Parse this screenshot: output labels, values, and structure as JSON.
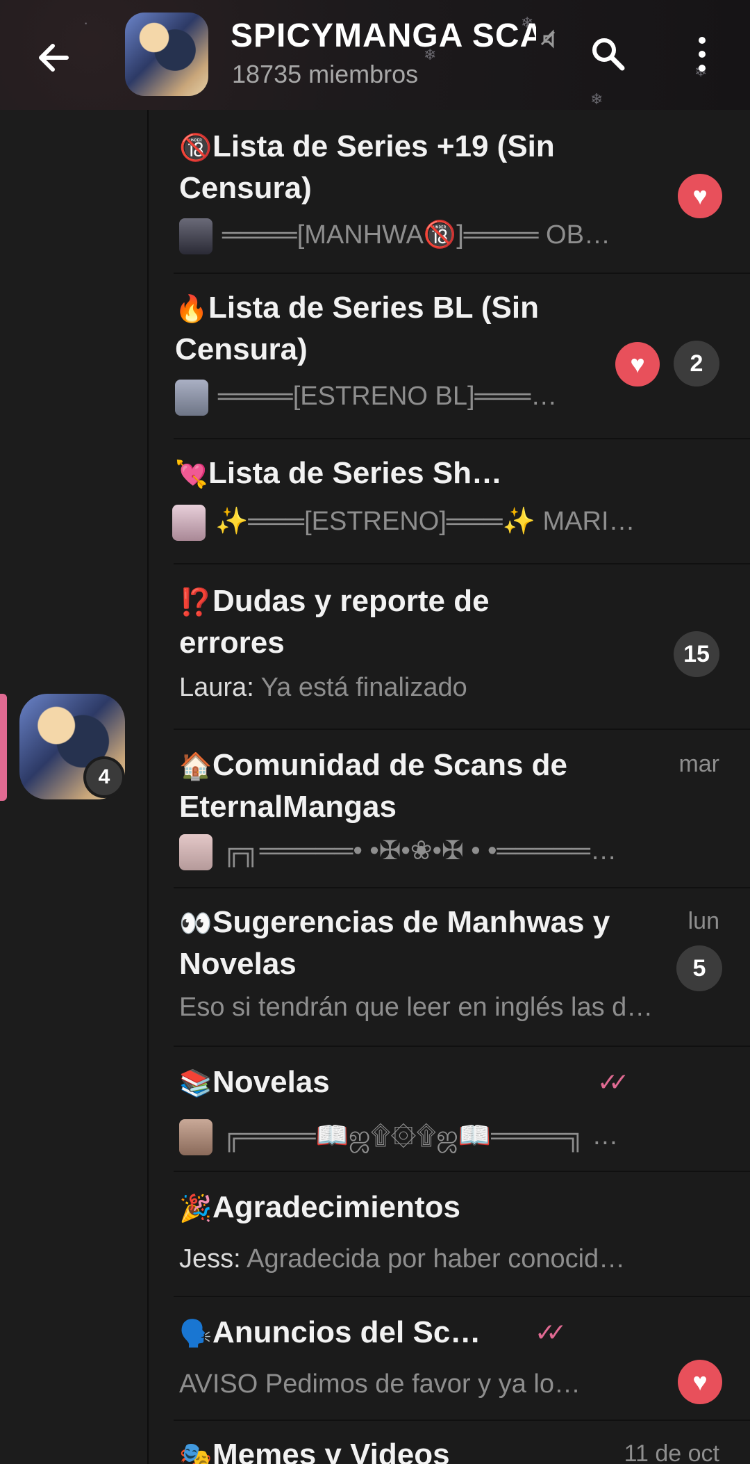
{
  "header": {
    "title": "SPICYMANGA SCANS",
    "members": "18735 miembros",
    "back_icon": "arrow-left-icon",
    "search_icon": "search-icon",
    "menu_icon": "more-vertical-icon"
  },
  "rail": {
    "unread": "4"
  },
  "colors": {
    "accent_pink": "#e06a92",
    "heart_red": "#e8505b",
    "background": "#1b1b1b"
  },
  "topics": [
    {
      "emoji": "🔞",
      "title": "Lista de Series +19 (Sin Censura)",
      "preview": "════[MANHWA🔞]════ OB…",
      "sender": "",
      "time": "",
      "badge": "",
      "reaction": "heart"
    },
    {
      "emoji": "🔥",
      "title": "Lista de Series BL (Sin Censura)",
      "preview": "════[ESTRENO BL]═══…",
      "sender": "",
      "time": "",
      "badge": "2",
      "reaction": "heart"
    },
    {
      "emoji": "💘",
      "title": "Lista de Series Sh…",
      "preview": "✨═══[ESTRENO]═══✨  MARI…",
      "sender": "",
      "time": "",
      "badge": "",
      "reaction": ""
    },
    {
      "emoji": "⁉️",
      "title": "Dudas y reporte de errores",
      "preview": "Ya está finalizado",
      "sender": "Laura:",
      "time": "",
      "badge": "15",
      "reaction": ""
    },
    {
      "emoji": "🏠",
      "title": "Comunidad de Scans de EternalMangas",
      "preview": "╔╗═════• •✠•❀•✠ • •═════…",
      "sender": "",
      "time": "mar",
      "badge": "",
      "reaction": ""
    },
    {
      "emoji": "👀",
      "title": "Sugerencias de Manhwas y Novelas",
      "preview": "Eso si tendrán que leer en inglés las d…",
      "sender": "",
      "time": "lun",
      "badge": "5",
      "reaction": ""
    },
    {
      "emoji": "📚",
      "title": "Novelas",
      "preview": "╔════📖ஜ۩۞۩ஜ📖════╗ …",
      "sender": "",
      "time": "",
      "badge": "",
      "reaction": "",
      "ticks": "✓✓"
    },
    {
      "emoji": "🎉",
      "title": "Agradecimientos",
      "preview": "Agradecida por haber conocid…",
      "sender": "Jess:",
      "time": "",
      "badge": "",
      "reaction": ""
    },
    {
      "emoji": "🗣️",
      "title": "Anuncios del Sc…",
      "preview": "AVISO  Pedimos de favor y ya lo…",
      "sender": "",
      "time": "",
      "badge": "",
      "reaction": "heart",
      "ticks": "✓✓"
    },
    {
      "emoji": "🎭",
      "title": "Memes y Videos",
      "preview": "",
      "sender": "",
      "time": "11 de oct",
      "badge": "",
      "reaction": ""
    }
  ]
}
